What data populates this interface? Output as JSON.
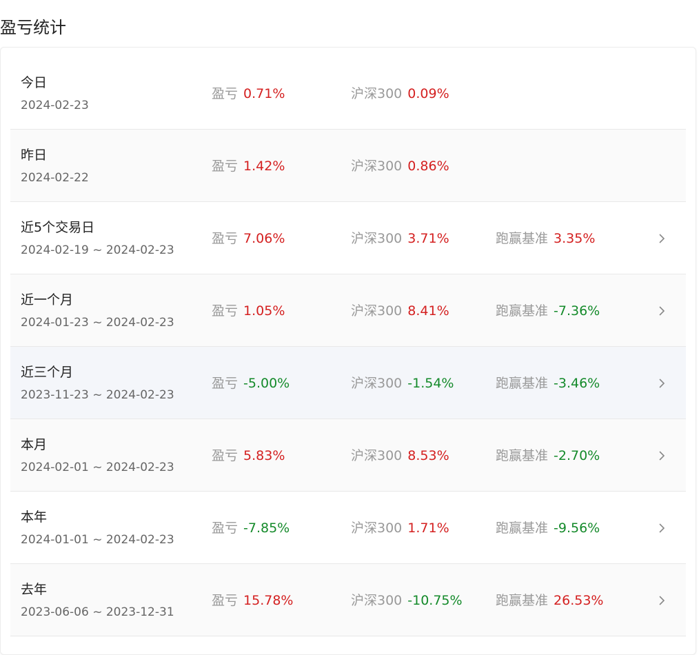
{
  "header": {
    "title": "盈亏统计"
  },
  "labels": {
    "pnl": "盈亏",
    "benchmark": "沪深300",
    "excess": "跑赢基准"
  },
  "colors": {
    "positive": "#d42020",
    "negative": "#148a2a"
  },
  "rows": [
    {
      "label": "今日",
      "date": "2024-02-23",
      "pnl": "0.71%",
      "benchmark": "0.09%",
      "excess": null,
      "has_detail": false
    },
    {
      "label": "昨日",
      "date": "2024-02-22",
      "pnl": "1.42%",
      "benchmark": "0.86%",
      "excess": null,
      "has_detail": false
    },
    {
      "label": "近5个交易日",
      "date": "2024-02-19 ~ 2024-02-23",
      "pnl": "7.06%",
      "benchmark": "3.71%",
      "excess": "3.35%",
      "has_detail": true
    },
    {
      "label": "近一个月",
      "date": "2024-01-23 ~ 2024-02-23",
      "pnl": "1.05%",
      "benchmark": "8.41%",
      "excess": "-7.36%",
      "has_detail": true
    },
    {
      "label": "近三个月",
      "date": "2023-11-23 ~ 2024-02-23",
      "pnl": "-5.00%",
      "benchmark": "-1.54%",
      "excess": "-3.46%",
      "has_detail": true
    },
    {
      "label": "本月",
      "date": "2024-02-01 ~ 2024-02-23",
      "pnl": "5.83%",
      "benchmark": "8.53%",
      "excess": "-2.70%",
      "has_detail": true
    },
    {
      "label": "本年",
      "date": "2024-01-01 ~ 2024-02-23",
      "pnl": "-7.85%",
      "benchmark": "1.71%",
      "excess": "-9.56%",
      "has_detail": true
    },
    {
      "label": "去年",
      "date": "2023-06-06 ~ 2023-12-31",
      "pnl": "15.78%",
      "benchmark": "-10.75%",
      "excess": "26.53%",
      "has_detail": true
    }
  ]
}
